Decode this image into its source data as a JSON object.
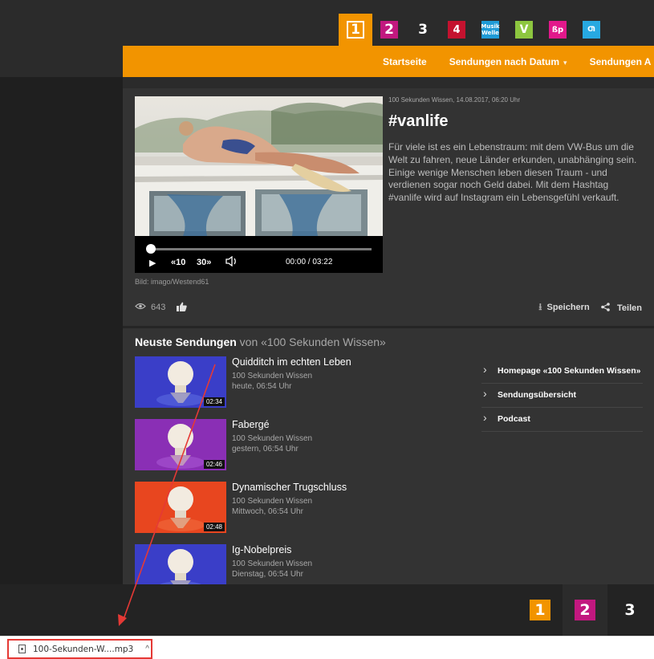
{
  "channels": [
    {
      "id": "1",
      "label": "1",
      "active": true
    },
    {
      "id": "2",
      "label": "2"
    },
    {
      "id": "3",
      "label": "3"
    },
    {
      "id": "4",
      "label": "4"
    },
    {
      "id": "musik",
      "label": "Musik Welle"
    },
    {
      "id": "v",
      "label": "V"
    },
    {
      "id": "p",
      "label": "ßp"
    },
    {
      "id": "x",
      "label": "Ƣ"
    }
  ],
  "nav": {
    "items": [
      "Startseite",
      "Sendungen nach Datum",
      "Sendungen A"
    ]
  },
  "player": {
    "rewind": "«10",
    "forward": "30»",
    "time": "00:00 / 03:22",
    "progress": 0
  },
  "article": {
    "caption": "Bild: imago/Westend61",
    "meta": "100 Sekunden Wissen, 14.08.2017, 06:20 Uhr",
    "title": "#vanlife",
    "description": "Für viele ist es ein Lebenstraum: mit dem VW-Bus um die Welt zu fahren, neue Länder erkunden, unabhänging sein. Einige wenige Menschen leben diesen Traum - und verdienen sogar noch Geld dabei. Mit dem Hashtag #vanlife wird auf Instagram ein Lebensgefühl verkauft.",
    "views": "643",
    "save_label": "Speichern",
    "share_label": "Teilen"
  },
  "latest": {
    "head_bold": "Neuste Sendungen",
    "head_rest": " von «100 Sekunden Wissen»",
    "episodes": [
      {
        "title": "Quidditch im echten Leben",
        "show": "100 Sekunden Wissen",
        "date": "heute, 06:54 Uhr",
        "duration": "02:34",
        "color": "#3a3ec8"
      },
      {
        "title": "Fabergé",
        "show": "100 Sekunden Wissen",
        "date": "gestern, 06:54 Uhr",
        "duration": "02:46",
        "color": "#8a2fb5"
      },
      {
        "title": "Dynamischer Trugschluss",
        "show": "100 Sekunden Wissen",
        "date": "Mittwoch, 06:54 Uhr",
        "duration": "02:48",
        "color": "#e8461f"
      },
      {
        "title": "Ig-Nobelpreis",
        "show": "100 Sekunden Wissen",
        "date": "Dienstag, 06:54 Uhr",
        "duration": "",
        "color": "#3a3ec8"
      }
    ]
  },
  "side_links": [
    "Homepage «100 Sekunden Wissen»",
    "Sendungsübersicht",
    "Podcast"
  ],
  "footer": {
    "logos": [
      "1",
      "2",
      "3"
    ]
  },
  "download": {
    "filename": "100-Sekunden-W....mp3"
  },
  "colors": {
    "accent": "#f29400",
    "annotation": "#e53935"
  }
}
